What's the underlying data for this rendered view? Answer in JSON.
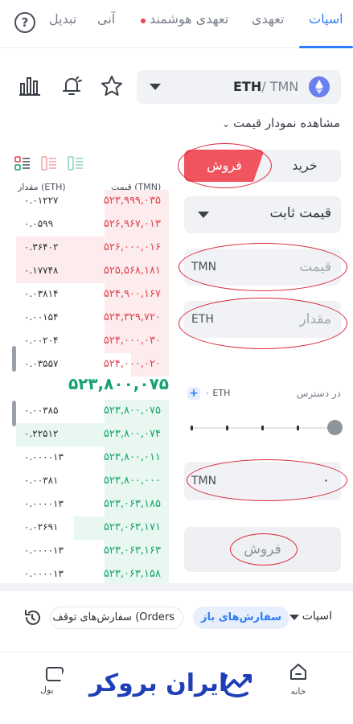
{
  "tabs": [
    {
      "label": "اسپات",
      "active": true
    },
    {
      "label": "تعهدی",
      "active": false
    },
    {
      "label": "تعهدی هوشمند",
      "active": false
    },
    {
      "label": "آنی",
      "active": false
    },
    {
      "label": "تبدیل",
      "active": false
    }
  ],
  "help_label": "?",
  "pair": {
    "base": "ETH",
    "separator": "/ ",
    "quote": "TMN"
  },
  "chart_toggle": "مشاهده نمودار قیمت",
  "order_form": {
    "sell_tab": "فروش",
    "buy_tab": "خرید",
    "order_type": "قیمت ثابت",
    "price_placeholder": "قیمت",
    "price_unit": "TMN",
    "amount_placeholder": "مقدار",
    "amount_unit": "ETH",
    "available_label": "در دسترس",
    "available_value": "۰ ETH",
    "add_label": "+",
    "total_unit": "TMN",
    "total_value": "۰",
    "slider_fraction": 1.0,
    "submit_label": "فروش"
  },
  "order_book": {
    "price_header": "قیمت (TMN)",
    "amount_header": "مقدار (ETH)",
    "asks": [
      {
        "price": "۵۲۳,۹۹۹,۰۳۵",
        "amount": "۰.۰۱۲۲۷",
        "depth": 0.42
      },
      {
        "price": "۵۲۶,۹۶۷,۰۱۳",
        "amount": "۰.۰۵۹۹",
        "depth": 0.42
      },
      {
        "price": "۵۲۶,۰۰۰,۰۱۶",
        "amount": "۰.۳۶۴۰۲",
        "depth": 1.0
      },
      {
        "price": "۵۲۵,۵۶۸,۱۸۱",
        "amount": "۰.۱۷۷۴۸",
        "depth": 1.0
      },
      {
        "price": "۵۲۴,۹۰۰,۱۶۷",
        "amount": "۰.۰۳۸۱۴",
        "depth": 0.42
      },
      {
        "price": "۵۲۴,۳۲۹,۷۲۰",
        "amount": "۰.۰۰۱۵۴",
        "depth": 0.42
      },
      {
        "price": "۵۲۴,۰۰۰,۰۳۰",
        "amount": "۰.۰۰۲۰۴",
        "depth": 0.42
      },
      {
        "price": "۵۲۴,۰۰۰,۰۲۰",
        "amount": "۰.۰۳۵۵۷",
        "depth": 0.25
      }
    ],
    "last_price": "۵۲۳,۸۰۰,۰۷۵",
    "bids": [
      {
        "price": "۵۲۳,۸۰۰,۰۷۵",
        "amount": "۰.۰۰۳۸۵",
        "depth": 0.42
      },
      {
        "price": "۵۲۳,۸۰۰,۰۷۴",
        "amount": "۰.۲۲۵۱۲",
        "depth": 1.0
      },
      {
        "price": "۵۲۳,۸۰۰,۰۱۱",
        "amount": "۰.۰۰۰۰۱۳",
        "depth": 0.42
      },
      {
        "price": "۵۲۳,۸۰۰,۰۰۰",
        "amount": "۰.۰۰۳۸۱",
        "depth": 0.42
      },
      {
        "price": "۵۲۳,۰۶۳,۱۸۵",
        "amount": "۰.۰۰۰۰۱۳",
        "depth": 0.42
      },
      {
        "price": "۵۲۳,۰۶۳,۱۷۱",
        "amount": "۰.۰۲۶۹۱",
        "depth": 0.62
      },
      {
        "price": "۵۲۳,۰۶۳,۱۶۳",
        "amount": "۰.۰۰۰۰۱۳",
        "depth": 0.42
      },
      {
        "price": "۵۲۳,۰۶۳,۱۵۸",
        "amount": "۰.۰۰۰۰۱۳",
        "depth": 0.42
      }
    ]
  },
  "orders_bar": {
    "spot_label": "اسپات",
    "open_orders": "سفارش‌های باز",
    "stop_orders": "سفارش‌های توقف (Orders"
  },
  "nav": {
    "home_label": "خانه",
    "wallet_fragment": "یول"
  },
  "brand": {
    "name": "ایران بروکر",
    "color": "#1f3fb6"
  },
  "colors": {
    "accent": "#2f7cf6",
    "sell": "#f0545f",
    "buy_green": "#15a36e",
    "highlight_ring": "#d9263a"
  }
}
